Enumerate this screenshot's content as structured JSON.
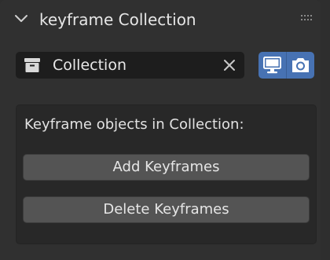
{
  "panel": {
    "title": "keyframe Collection"
  },
  "collection_field": {
    "value": "Collection"
  },
  "subpanel": {
    "label": "Keyframe objects in Collection:",
    "add_button": "Add Keyframes",
    "delete_button": "Delete Keyframes"
  },
  "colors": {
    "accent": "#4772b3",
    "button": "#545454",
    "field": "#1d1d1d",
    "panel": "#303030"
  },
  "icons": [
    "chevron-down-icon",
    "grip-icon",
    "collection-box-icon",
    "clear-x-icon",
    "monitor-icon",
    "camera-icon"
  ]
}
